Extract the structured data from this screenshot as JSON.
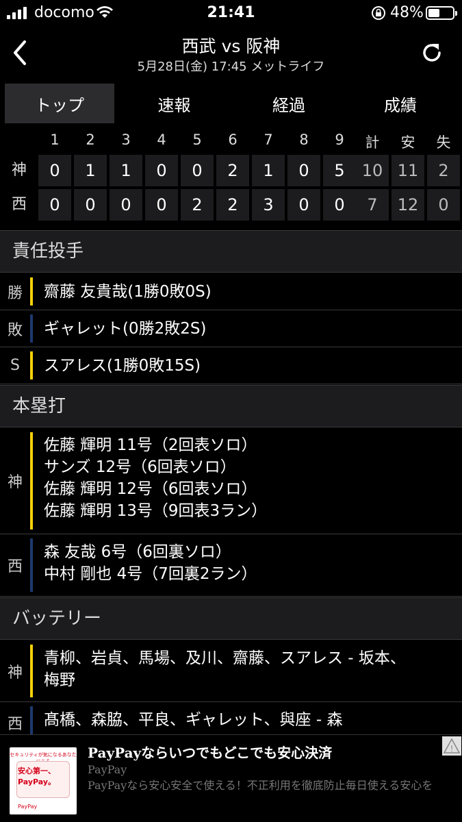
{
  "status_bar": {
    "carrier": "docomo",
    "time": "21:41",
    "battery_pct": "48%",
    "battery_level": 0.48
  },
  "header": {
    "title": "西武 vs 阪神",
    "subtitle": "5月28日(金) 17:45 メットライフ"
  },
  "tabs": [
    "トップ",
    "速報",
    "経過",
    "成績"
  ],
  "active_tab": 0,
  "scoreboard": {
    "innings": [
      "1",
      "2",
      "3",
      "4",
      "5",
      "6",
      "7",
      "8",
      "9"
    ],
    "totals_headers": [
      "計",
      "安",
      "失"
    ],
    "rows": [
      {
        "team": "神",
        "scores": [
          "0",
          "1",
          "1",
          "0",
          "0",
          "2",
          "1",
          "0",
          "5"
        ],
        "totals": [
          "10",
          "11",
          "2"
        ]
      },
      {
        "team": "西",
        "scores": [
          "0",
          "0",
          "0",
          "0",
          "2",
          "2",
          "3",
          "0",
          "0"
        ],
        "totals": [
          "7",
          "12",
          "0"
        ]
      }
    ]
  },
  "pitchers": {
    "heading": "責任投手",
    "rows": [
      {
        "label": "勝",
        "text": "齋藤 友貴哉(1勝0敗0S)",
        "color": "#f5d00a"
      },
      {
        "label": "敗",
        "text": "ギャレット(0勝2敗2S)",
        "color": "#1d3a6e"
      },
      {
        "label": "S",
        "text": "スアレス(1勝0敗15S)",
        "color": "#f5d00a"
      }
    ]
  },
  "homeruns": {
    "heading": "本塁打",
    "teams": [
      {
        "label": "神",
        "color": "#f5d00a",
        "lines": [
          "佐藤 輝明 11号（2回表ソロ）",
          "サンズ 12号（6回表ソロ）",
          "佐藤 輝明 12号（6回表ソロ）",
          "佐藤 輝明 13号（9回表3ラン）"
        ]
      },
      {
        "label": "西",
        "color": "#1d3a6e",
        "lines": [
          "森 友哉 6号（6回裏ソロ）",
          "中村 剛也 4号（7回裏2ラン）"
        ]
      }
    ]
  },
  "battery": {
    "heading": "バッテリー",
    "teams": [
      {
        "label": "神",
        "color": "#f5d00a",
        "lines": [
          "青柳、岩貞、馬場、及川、齋藤、スアレス - 坂本、",
          "梅野"
        ]
      },
      {
        "label": "西",
        "color": "#1d3a6e",
        "lines": [
          "髙橋、森脇、平良、ギャレット、與座 - 森"
        ]
      }
    ]
  },
  "ad": {
    "image_text1": "セキュリティが気になるあなたにこそ",
    "image_text2": "安心第一、",
    "image_text3": "PayPay。",
    "image_logo": "PayPay",
    "title": "PayPayならいつでもどこでも安心決済",
    "brand": "PayPay",
    "description": "PayPayなら安心安全で使える！不正利用を徹底防止毎日使える安心を"
  }
}
